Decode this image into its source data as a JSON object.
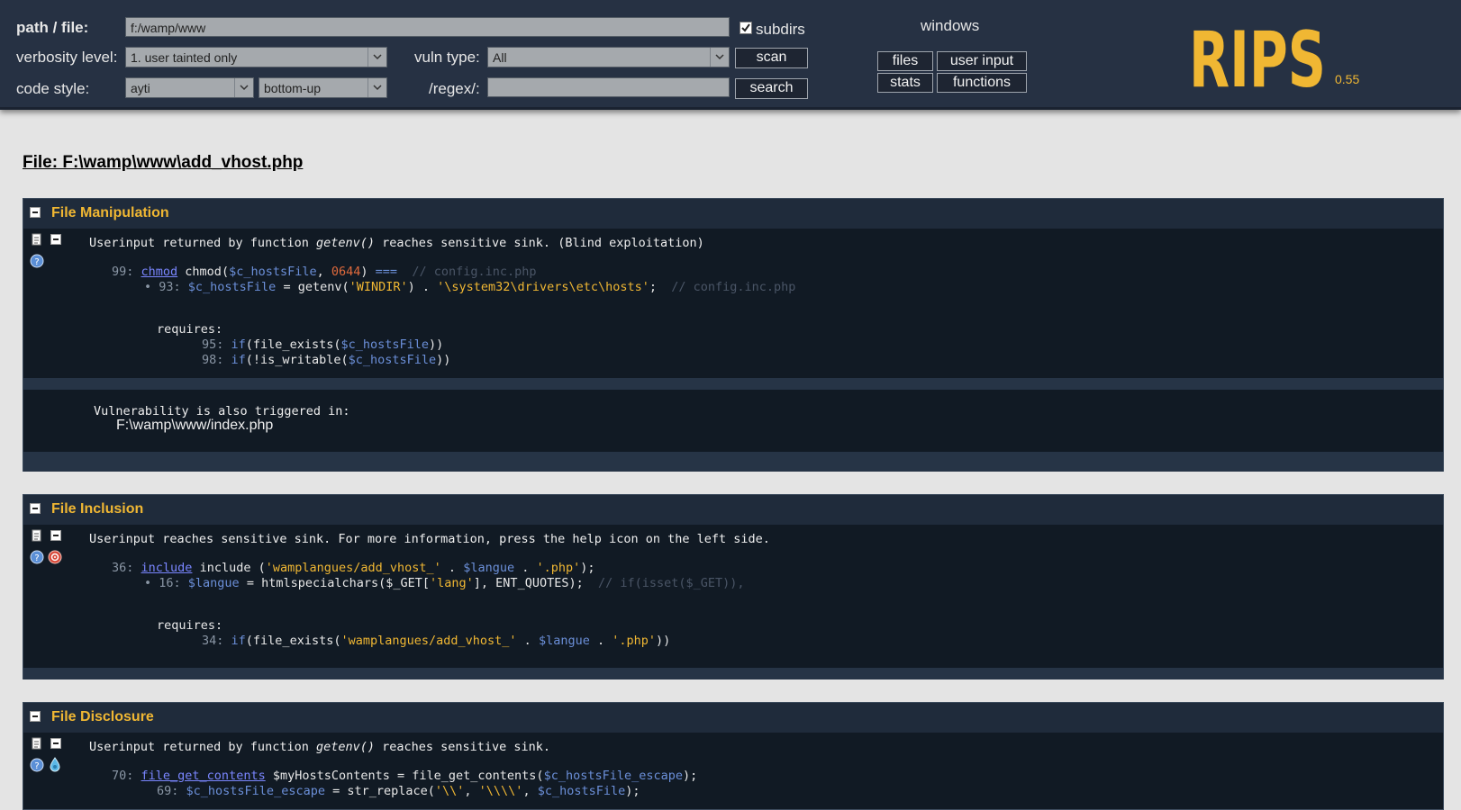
{
  "header": {
    "path_label": "path / file:",
    "path_value": "f:/wamp/www",
    "subdirs_label": "subdirs",
    "subdirs_checked": true,
    "os_label": "windows",
    "verbosity_label": "verbosity level:",
    "verbosity_value": "1. user tainted only",
    "vuln_type_label": "vuln type:",
    "vuln_type_value": "All",
    "scan_label": "scan",
    "code_style_label": "code style:",
    "code_style_value": "ayti",
    "direction_value": "bottom-up",
    "regex_label": "/regex/:",
    "regex_value": "",
    "search_label": "search",
    "nav": {
      "files": "files",
      "user_input": "user input",
      "stats": "stats",
      "functions": "functions"
    },
    "logo_text": "RIPS",
    "version": "0.55",
    "colors": {
      "logo": "#f0b733",
      "header_bg": "#263143"
    }
  },
  "file_title": "File: F:\\wamp\\www\\add_vhost.php",
  "vulns": [
    {
      "title": "File Manipulation",
      "description": "Userinput returned by function getenv() reaches sensitive sink. (Blind exploitation)",
      "desc_prefix": "Userinput returned by function ",
      "desc_fn": "getenv()",
      "desc_suffix": " reaches sensitive sink. (Blind exploitation)",
      "sink": {
        "line": "99:",
        "fn": "chmod",
        "code_a": " chmod(",
        "var": "$c_hostsFile",
        "code_b": ", ",
        "num": "0644",
        "code_c": ") ",
        "op": "===",
        "comment": "  // config.inc.php"
      },
      "trace": {
        "line": "• 93:",
        "var": "$c_hostsFile",
        "code_a": " = getenv(",
        "str1": "'WINDIR'",
        "code_b": ") . ",
        "str2": "'\\system32\\drivers\\etc\\hosts'",
        "code_c": ";",
        "comment": "  // config.inc.php"
      },
      "requires_label": "requires:",
      "requires": [
        {
          "line": "95:",
          "kw": "if",
          "code_a": "(file_exists(",
          "var": "$c_hostsFile",
          "code_b": "))"
        },
        {
          "line": "98:",
          "kw": "if",
          "code_a": "(!is_writable(",
          "var": "$c_hostsFile",
          "code_b": "))"
        }
      ],
      "also_label": "Vulnerability is also triggered in:",
      "also_file": "F:\\wamp\\www/index.php"
    },
    {
      "title": "File Inclusion",
      "description": "Userinput reaches sensitive sink. For more information, press the help icon on the left side.",
      "sink": {
        "line": "36:",
        "fn": "include",
        "code_a": " include (",
        "str1": "'wamplangues/add_vhost_'",
        "code_b": " . ",
        "var": "$langue",
        "code_c": " . ",
        "str2": "'.php'",
        "code_d": ");"
      },
      "trace": {
        "line": "• 16:",
        "var": "$langue",
        "code_a": " = htmlspecialchars($_GET[",
        "str1": "'lang'",
        "code_b": "], ENT_QUOTES);",
        "comment": "  // if(isset($_GET)),"
      },
      "requires_label": "requires:",
      "requires": [
        {
          "line": "34:",
          "kw": "if",
          "code_a": "(file_exists(",
          "str1": "'wamplangues/add_vhost_'",
          "code_b": " . ",
          "var": "$langue",
          "code_c": " . ",
          "str2": "'.php'",
          "code_d": "))"
        }
      ]
    },
    {
      "title": "File Disclosure",
      "description": "Userinput returned by function getenv() reaches sensitive sink.",
      "desc_prefix": "Userinput returned by function ",
      "desc_fn": "getenv()",
      "desc_suffix": " reaches sensitive sink.",
      "sink": {
        "line": "70:",
        "fn": "file_get_contents",
        "code_a": " $myHostsContents = file_get_contents(",
        "var": "$c_hostsFile_escape",
        "code_b": ");"
      },
      "trace": {
        "line": "69:",
        "var": "$c_hostsFile_escape",
        "code_a": " = str_replace(",
        "str1": "'\\\\'",
        "code_b": ", ",
        "str2": "'\\\\\\\\'",
        "code_c": ", ",
        "var2": "$c_hostsFile",
        "code_d": ");"
      }
    }
  ]
}
